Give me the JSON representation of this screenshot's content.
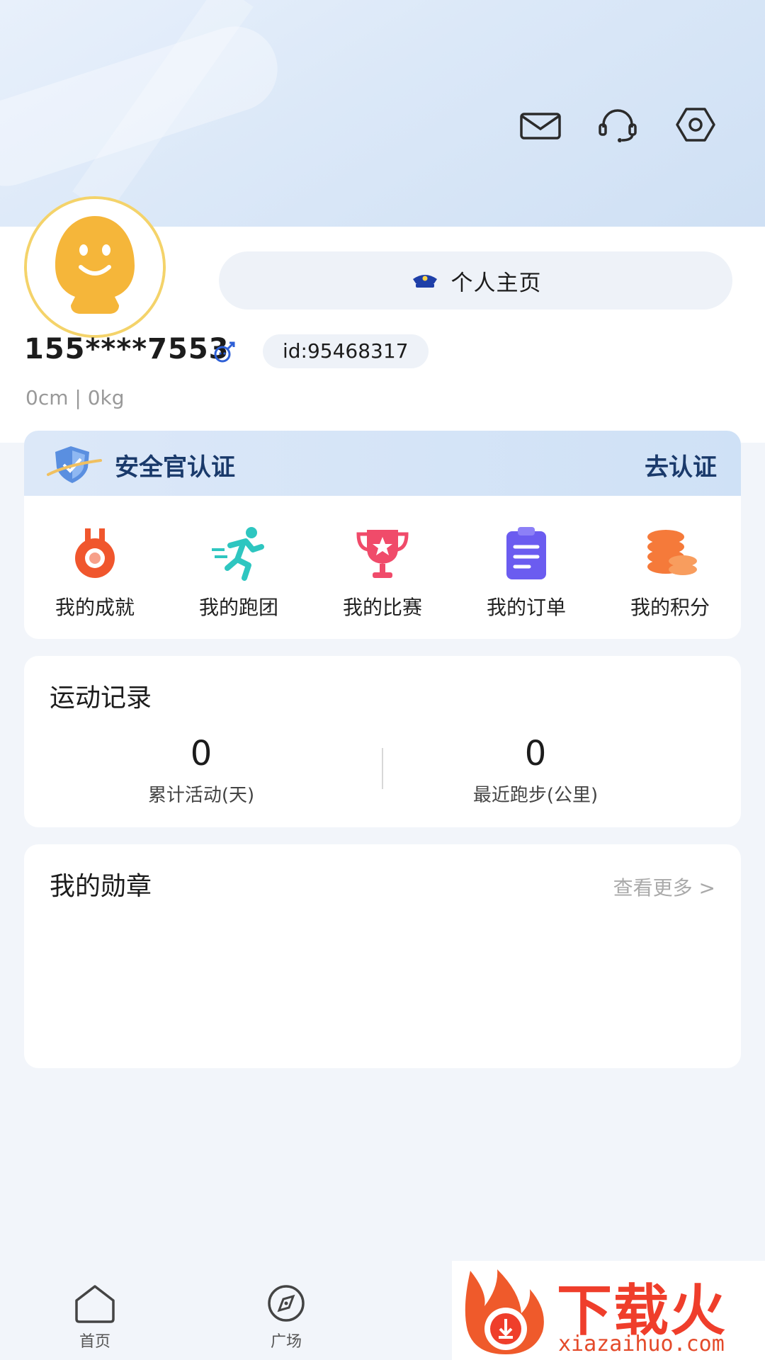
{
  "header": {
    "icons": [
      "mail-icon",
      "headset-icon",
      "settings-icon"
    ]
  },
  "profile": {
    "homepage_label": "个人主页",
    "phone": "155****7553",
    "id_badge": "id:95468317",
    "body_info": "0cm | 0kg"
  },
  "certification": {
    "title": "安全官认证",
    "action": "去认证"
  },
  "quick_links": [
    {
      "label": "我的成就",
      "icon": "medal-icon"
    },
    {
      "label": "我的跑团",
      "icon": "runner-icon"
    },
    {
      "label": "我的比赛",
      "icon": "trophy-icon"
    },
    {
      "label": "我的订单",
      "icon": "clipboard-icon"
    },
    {
      "label": "我的积分",
      "icon": "coins-icon"
    }
  ],
  "sport_record": {
    "title": "运动记录",
    "stats": [
      {
        "value": "0",
        "label": "累计活动(天)"
      },
      {
        "value": "0",
        "label": "最近跑步(公里)"
      }
    ]
  },
  "medals": {
    "title": "我的勋章",
    "more": "查看更多 >"
  },
  "tabbar": {
    "tabs": [
      {
        "label": "首页",
        "icon": "home-icon"
      },
      {
        "label": "广场",
        "icon": "compass-icon"
      }
    ]
  },
  "watermark": {
    "text": "下载火",
    "url": "xiazaihuo.com"
  },
  "colors": {
    "accent_navy": "#1a3a6b",
    "avatar_ring": "#f4d36a",
    "page_bg": "#f2f5fa"
  }
}
